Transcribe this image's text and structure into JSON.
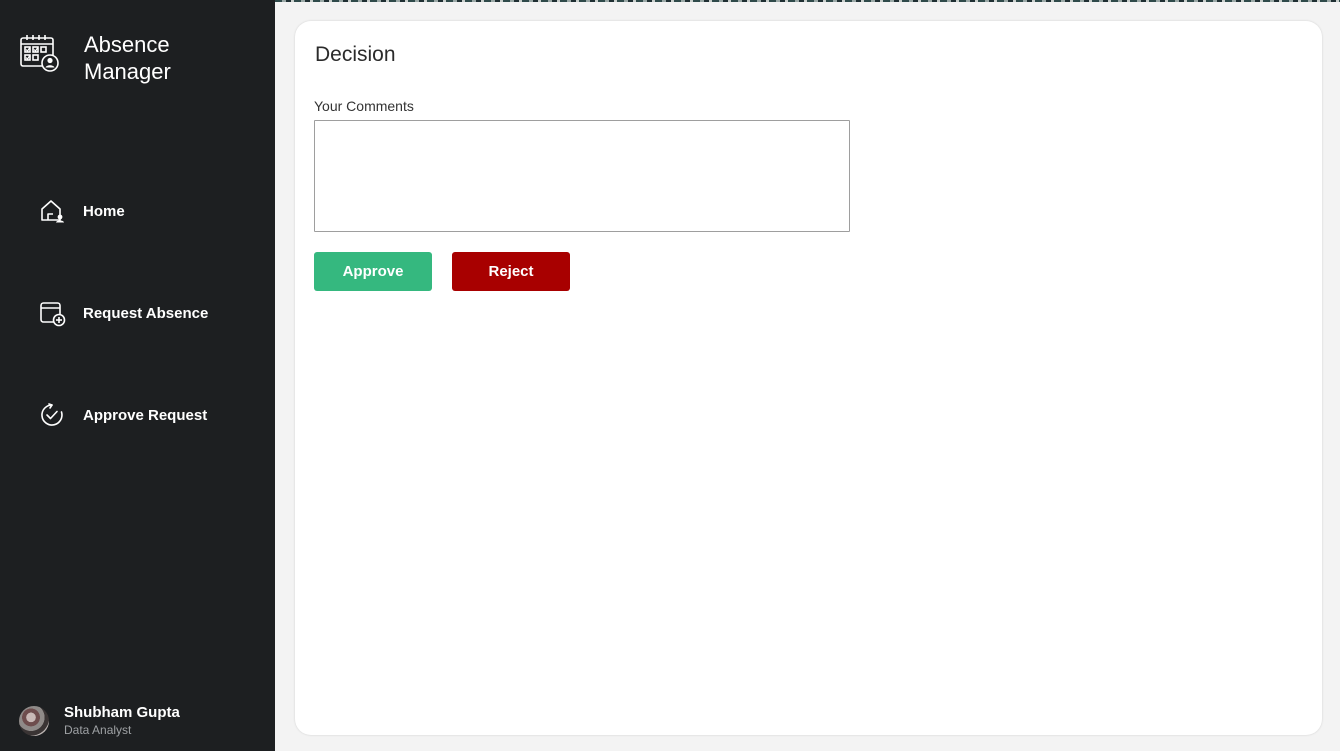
{
  "app": {
    "title": "Absence Manager",
    "icon": "calendar-person-icon"
  },
  "sidebar": {
    "items": [
      {
        "label": "Home",
        "icon": "home-icon"
      },
      {
        "label": "Request Absence",
        "icon": "calendar-add-icon"
      },
      {
        "label": "Approve Request",
        "icon": "check-circle-icon"
      }
    ]
  },
  "user": {
    "name": "Shubham Gupta",
    "role": "Data Analyst",
    "icon": "avatar"
  },
  "decision": {
    "title": "Decision",
    "comments_label": "Your Comments",
    "comments_value": "",
    "approve_label": "Approve",
    "reject_label": "Reject"
  },
  "colors": {
    "sidebar_bg": "#1d1f21",
    "approve": "#35b87f",
    "reject": "#a80000",
    "page_bg": "#f3f3f3"
  }
}
